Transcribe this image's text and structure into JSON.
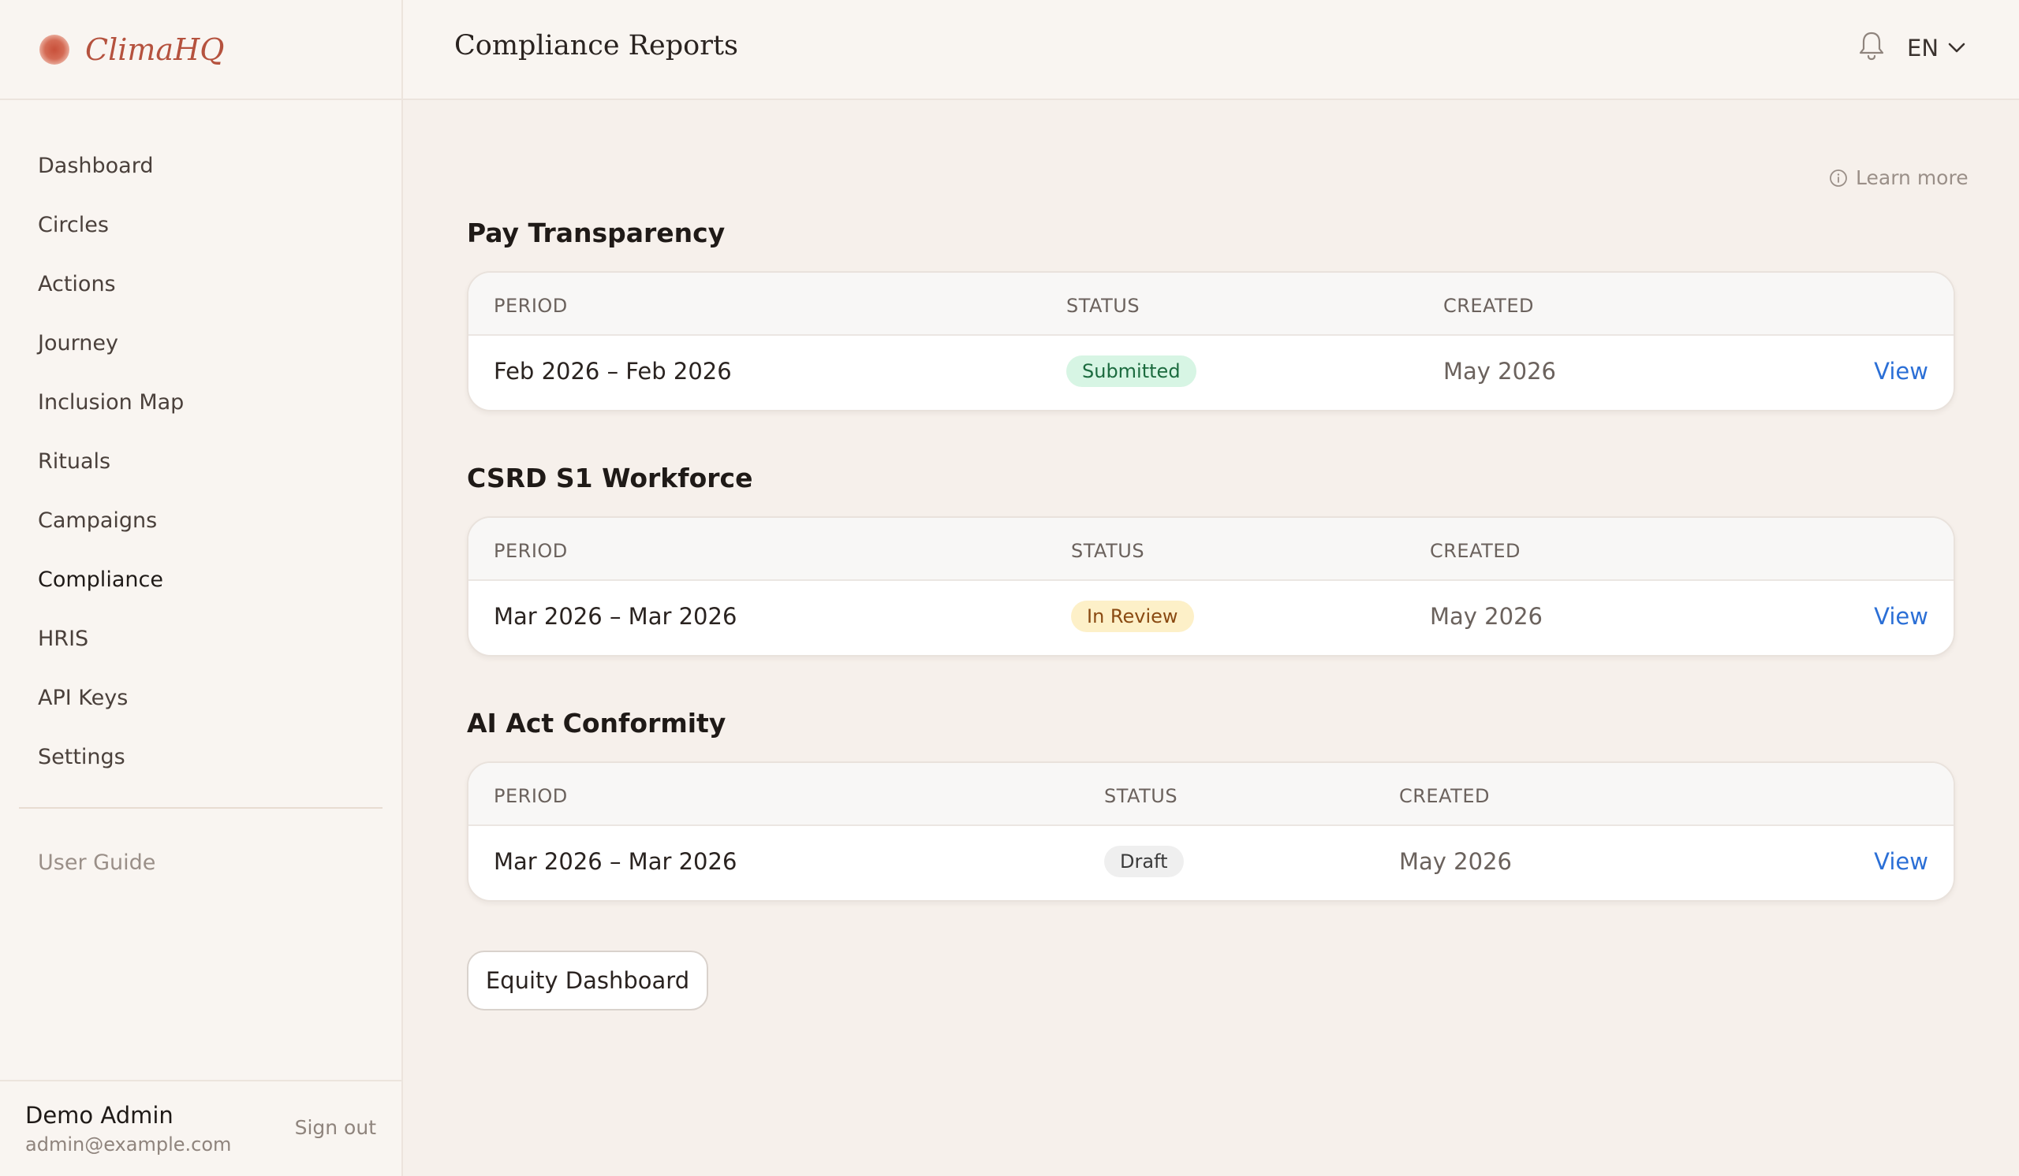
{
  "app": {
    "name": "ClimaHQ"
  },
  "sidebar": {
    "items": [
      {
        "label": "Dashboard"
      },
      {
        "label": "Circles"
      },
      {
        "label": "Actions"
      },
      {
        "label": "Journey"
      },
      {
        "label": "Inclusion Map"
      },
      {
        "label": "Rituals"
      },
      {
        "label": "Campaigns"
      },
      {
        "label": "Compliance",
        "active": true
      },
      {
        "label": "HRIS"
      },
      {
        "label": "API Keys"
      },
      {
        "label": "Settings"
      }
    ],
    "guide_label": "User Guide",
    "user": {
      "name": "Demo Admin",
      "email": "admin@example.com",
      "signout_label": "Sign out"
    }
  },
  "header": {
    "title": "Compliance Reports",
    "language": "EN",
    "notification_icon": "bell-icon"
  },
  "main": {
    "learn_more_label": "Learn more",
    "columns": {
      "period": "PERIOD",
      "status": "STATUS",
      "created": "CREATED"
    },
    "reports": [
      {
        "title": "Pay Transparency",
        "period": "Feb 2026 – Feb 2026",
        "status": "Submitted",
        "created": "May 2026",
        "action": "View"
      },
      {
        "title": "CSRD S1 Workforce",
        "period": "Mar 2026 – Mar 2026",
        "status": "In Review",
        "created": "May 2026",
        "action": "View"
      },
      {
        "title": "AI Act Conformity",
        "period": "Mar 2026 – Mar 2026",
        "status": "Draft",
        "created": "May 2026",
        "action": "View"
      }
    ],
    "equity_button_label": "Equity Dashboard"
  },
  "colors": {
    "brand": "#b5523e",
    "link": "#2b6fd6",
    "submitted_bg": "#d7f5e4",
    "in_review_bg": "#fdf0c8",
    "draft_bg": "#efefef"
  }
}
